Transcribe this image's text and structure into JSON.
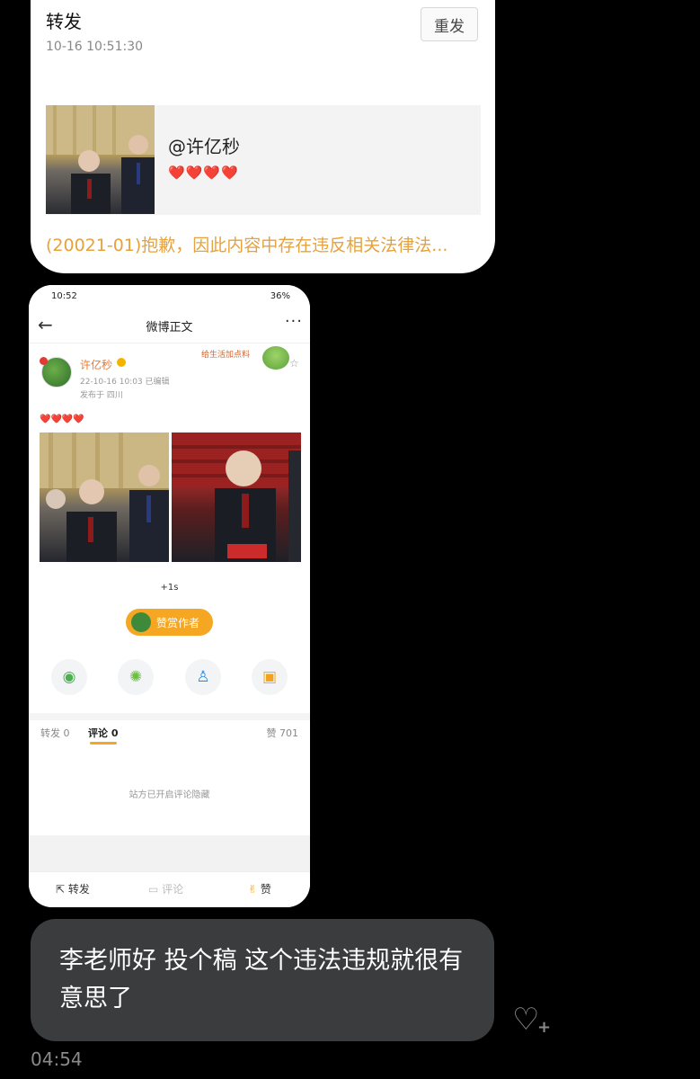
{
  "repost_card": {
    "title": "转发",
    "timestamp": "10-16 10:51:30",
    "resend_button": "重发",
    "quoted_handle": "@许亿秒",
    "quoted_hearts": "❤️❤️❤️❤️",
    "notice": "(20021-01)抱歉，因此内容中存在违反相关法律法..."
  },
  "phone_screenshot": {
    "status_bar": {
      "time": "10:52",
      "battery": "36%"
    },
    "nav": {
      "title": "微博正文"
    },
    "post": {
      "username": "许亿秒",
      "meta": "22-10-16 10:03  已编辑",
      "location": "发布于 四川",
      "sticker_text": "给生活加点料",
      "hearts": "❤️❤️❤️❤️",
      "like_animation": "+1s",
      "reward_button": "赞赏作者"
    },
    "share_icons": [
      "wechat-icon",
      "moments-icon",
      "qq-icon",
      "save-image-icon"
    ],
    "tabs": {
      "repost": "转发 0",
      "comments": "评论 0",
      "likes": "赞 701"
    },
    "comments_hidden_note": "站方已开启评论隐藏",
    "action_bar": {
      "repost": "转发",
      "comment": "评论",
      "like": "赞"
    }
  },
  "chat": {
    "message": "李老师好 投个稿 这个违法违规就很有意思了",
    "time": "04:54"
  }
}
